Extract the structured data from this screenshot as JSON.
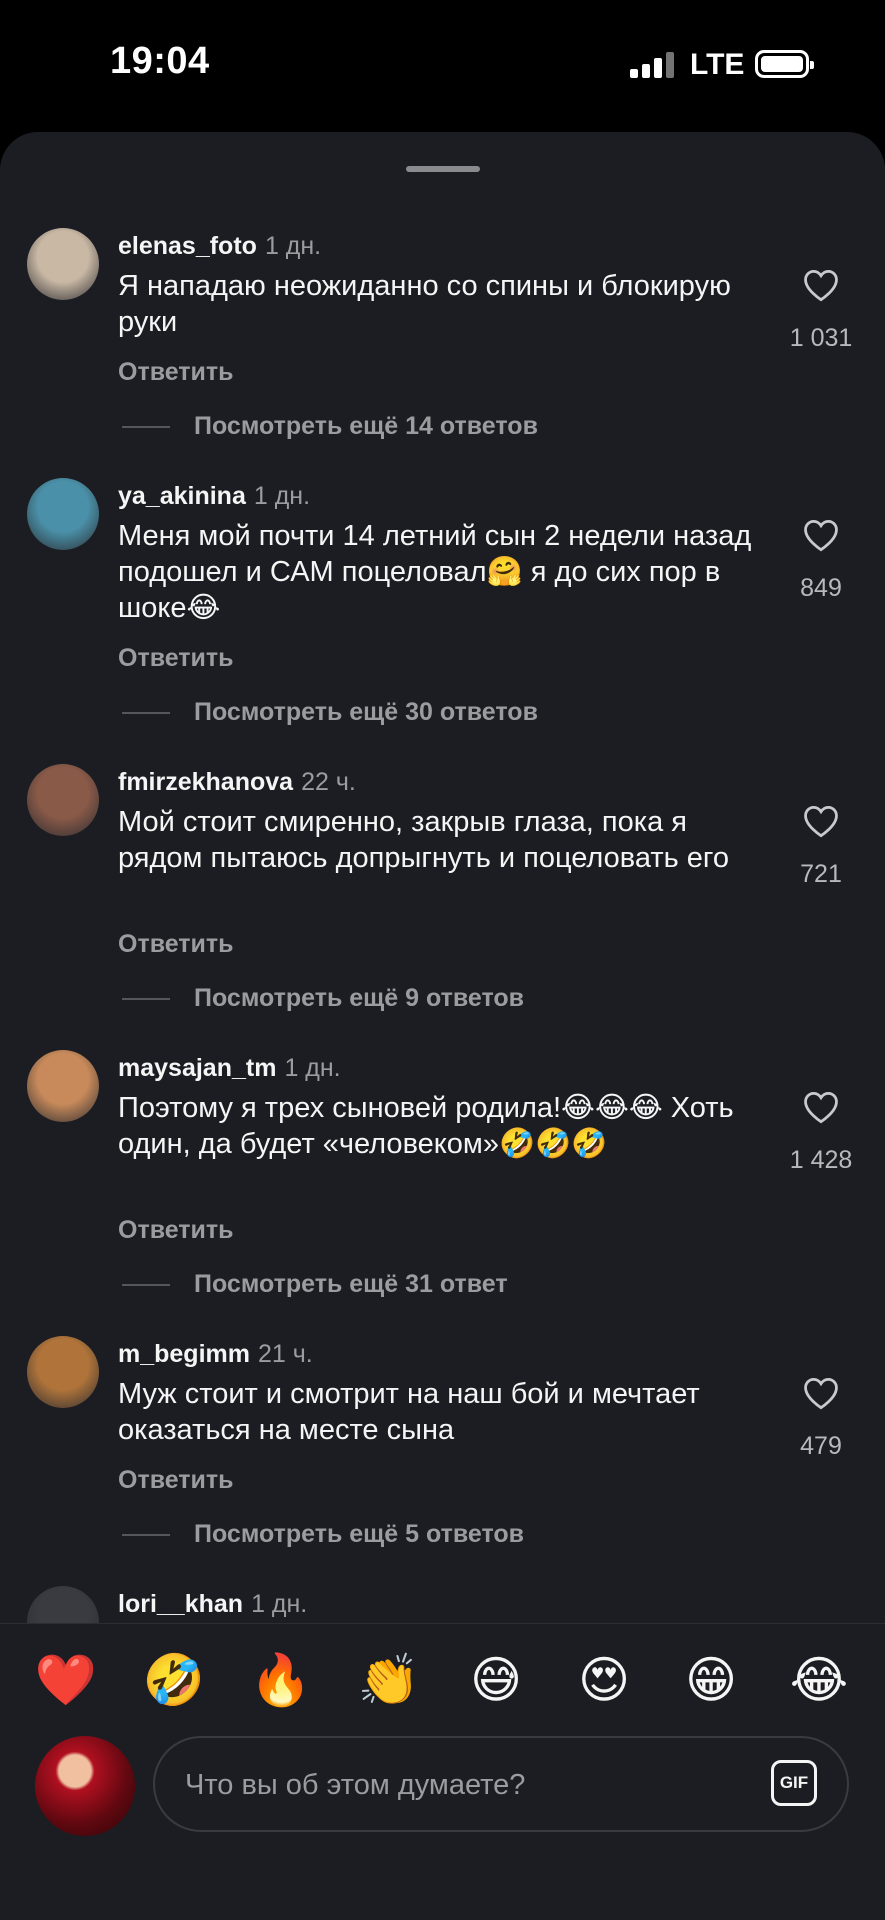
{
  "status": {
    "time": "19:04",
    "network": "LTE"
  },
  "comments": [
    {
      "username": "elenas_foto",
      "time": "1 дн.",
      "text": "Я нападаю неожиданно со спины и блокирую руки",
      "reply": "Ответить",
      "likes": "1 031",
      "more": "Посмотреть ещё 14 ответов",
      "avatar_color": "#c9b8a4"
    },
    {
      "username": "ya_akinina",
      "time": "1 дн.",
      "text": "Меня мой почти 14 летний сын 2 недели назад подошел и САМ поцеловал🤗 я до сих пор в шоке😂",
      "reply": "Ответить",
      "likes": "849",
      "more": "Посмотреть ещё 30 ответов",
      "avatar_color": "#4a90a8"
    },
    {
      "username": "fmirzekhanova",
      "time": "22 ч.",
      "text": "Мой стоит смиренно, закрыв глаза, пока я рядом пытаюсь допрыгнуть и поцеловать его",
      "reply": "Ответить",
      "likes": "721",
      "more": "Посмотреть ещё 9 ответов",
      "avatar_color": "#8a5a48"
    },
    {
      "username": "maysajan_tm",
      "time": "1 дн.",
      "text": "Поэтому я трех сыновей родила!😂😂😂 Хоть один, да будет «человеком»🤣🤣🤣",
      "reply": "Ответить",
      "likes": "1 428",
      "more": "Посмотреть ещё 31 ответ",
      "avatar_color": "#c88a5a"
    },
    {
      "username": "m_begimm",
      "time": "21 ч.",
      "text": "Муж стоит и смотрит на наш бой и мечтает оказаться на месте сына",
      "reply": "Ответить",
      "likes": "479",
      "more": "Посмотреть ещё 5 ответов",
      "avatar_color": "#b0743a"
    },
    {
      "username": "lori__khan",
      "time": "1 дн.",
      "text": "",
      "reply": "",
      "likes": "",
      "more": "",
      "avatar_color": "#3a3b40"
    }
  ],
  "reactions": [
    "❤️",
    "🤣",
    "🔥",
    "👏",
    "😅",
    "😍",
    "😁",
    "😂"
  ],
  "composer": {
    "placeholder": "Что вы об этом думаете?",
    "gif_label": "GIF"
  }
}
